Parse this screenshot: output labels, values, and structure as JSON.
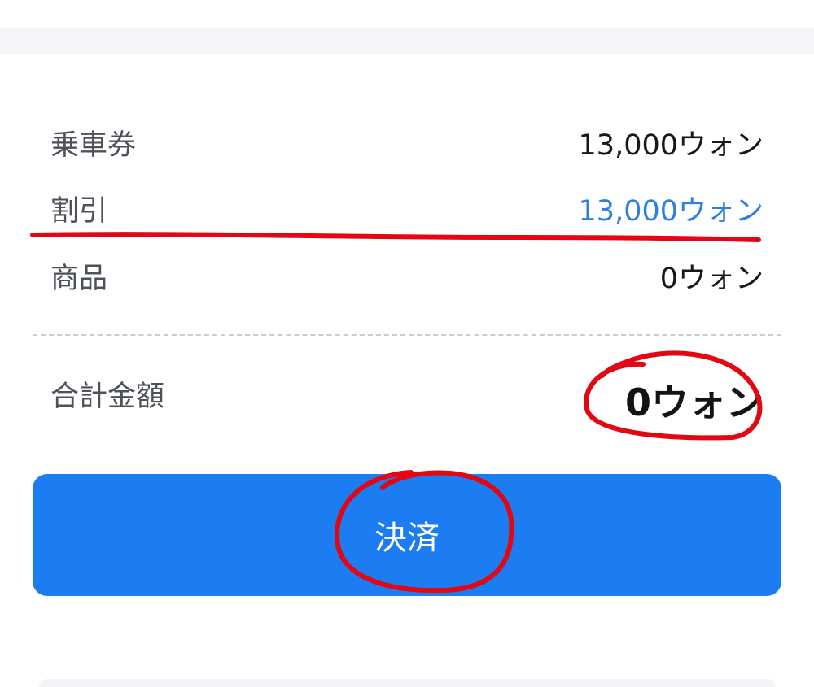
{
  "fare_breakdown": {
    "items": [
      {
        "label": "乗車券",
        "value": "13,000ウォン"
      },
      {
        "label": "割引",
        "value": "13,000ウォン"
      },
      {
        "label": "商品",
        "value": "0ウォン"
      }
    ]
  },
  "total": {
    "label": "合計金額",
    "value": "0ウォン"
  },
  "pay_button": {
    "label": "決済"
  },
  "colors": {
    "button": "#1c7cf1",
    "discount": "#2f7fde",
    "annotation": "#e30613"
  }
}
